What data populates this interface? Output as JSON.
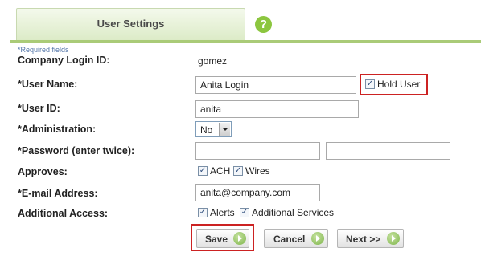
{
  "tab": {
    "title": "User Settings"
  },
  "help_icon": {
    "glyph": "?"
  },
  "form": {
    "required_note": "*Required fields",
    "company_login_id": {
      "label": "Company Login ID:",
      "value": "gomez"
    },
    "user_name": {
      "label": "*User Name:",
      "value": "Anita Login"
    },
    "hold_user": {
      "label": "Hold User",
      "checked": true
    },
    "user_id": {
      "label": "*User ID:",
      "value": "anita"
    },
    "administration": {
      "label": "*Administration:",
      "selected": "No"
    },
    "password": {
      "label": "*Password (enter twice):",
      "value1": "",
      "value2": ""
    },
    "approves": {
      "label": "Approves:",
      "options": [
        {
          "label": "ACH",
          "checked": true
        },
        {
          "label": "Wires",
          "checked": true
        }
      ]
    },
    "email": {
      "label": "*E-mail Address:",
      "value": "anita@company.com"
    },
    "additional_access": {
      "label": "Additional Access:",
      "options": [
        {
          "label": "Alerts",
          "checked": true
        },
        {
          "label": "Additional Services",
          "checked": true
        }
      ]
    }
  },
  "buttons": {
    "save": "Save",
    "cancel": "Cancel",
    "next": "Next >>"
  },
  "checkmark": "✓",
  "colors": {
    "accent_green": "#8cc63f",
    "highlight_red": "#cc2222",
    "tab_bg": "#dcebc7"
  }
}
